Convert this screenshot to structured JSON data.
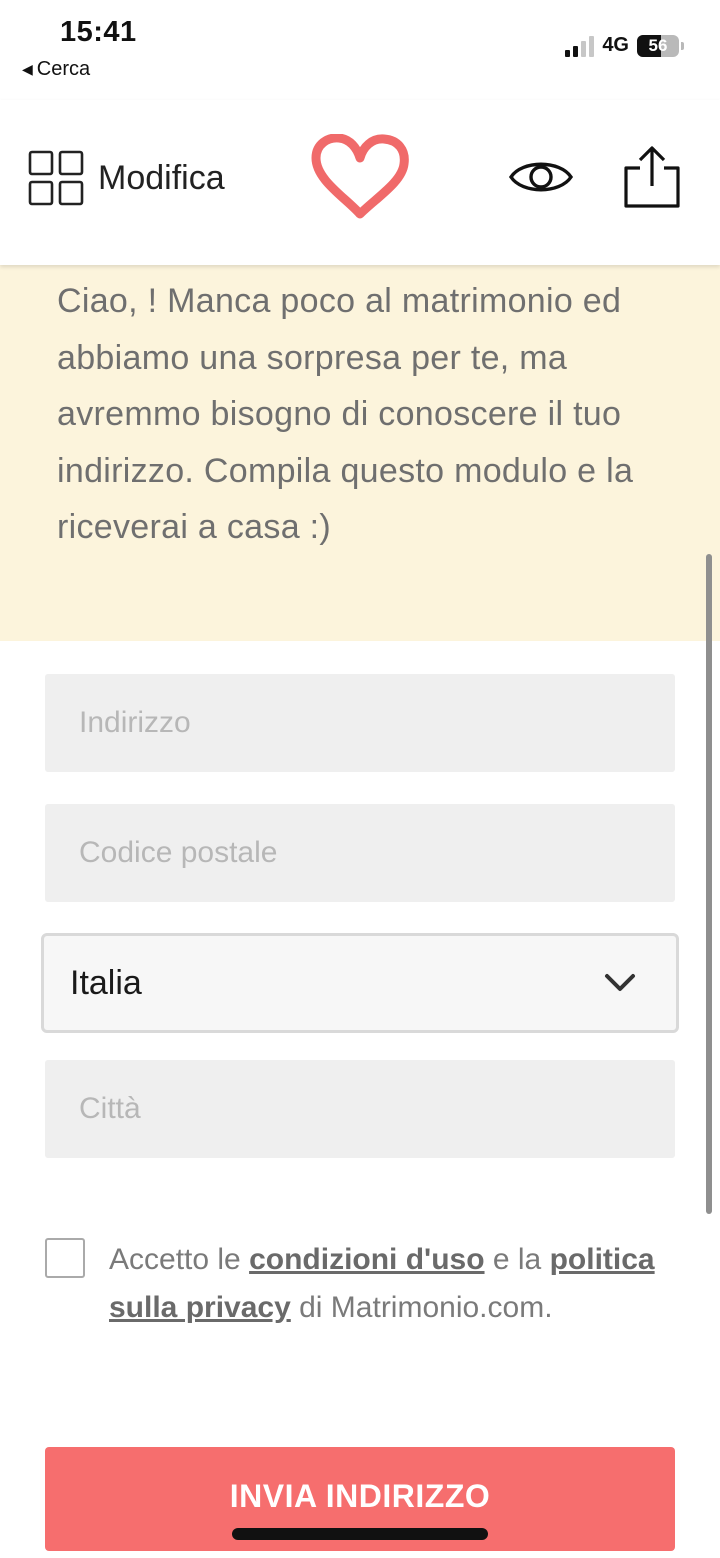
{
  "status_bar": {
    "time": "15:41",
    "back_label": "Cerca",
    "network": "4G",
    "battery": "56",
    "battery_percent": 56
  },
  "header": {
    "edit_label": "Modifica",
    "icons": [
      "grid-icon",
      "heart-logo-icon",
      "eye-icon",
      "share-icon"
    ],
    "accent_color": "#f06a6a"
  },
  "message": {
    "text": "Ciao, ! Manca poco al matrimonio ed abbiamo una sorpresa per te, ma avremmo bisogno di conoscere il tuo indirizzo. Compila questo modulo e la riceverai a casa :)",
    "background_color": "#fcf4dc"
  },
  "form": {
    "address_placeholder": "Indirizzo",
    "postal_code_placeholder": "Codice postale",
    "country_value": "Italia",
    "city_placeholder": "Città",
    "consent": {
      "prefix": "Accetto le",
      "terms_link": "condizioni d'uso",
      "middle": "e la",
      "privacy_link": "politica sulla privacy",
      "suffix": "di Matrimonio.com."
    },
    "submit_label": "INVIA INDIRIZZO",
    "submit_color": "#f66e6e"
  }
}
